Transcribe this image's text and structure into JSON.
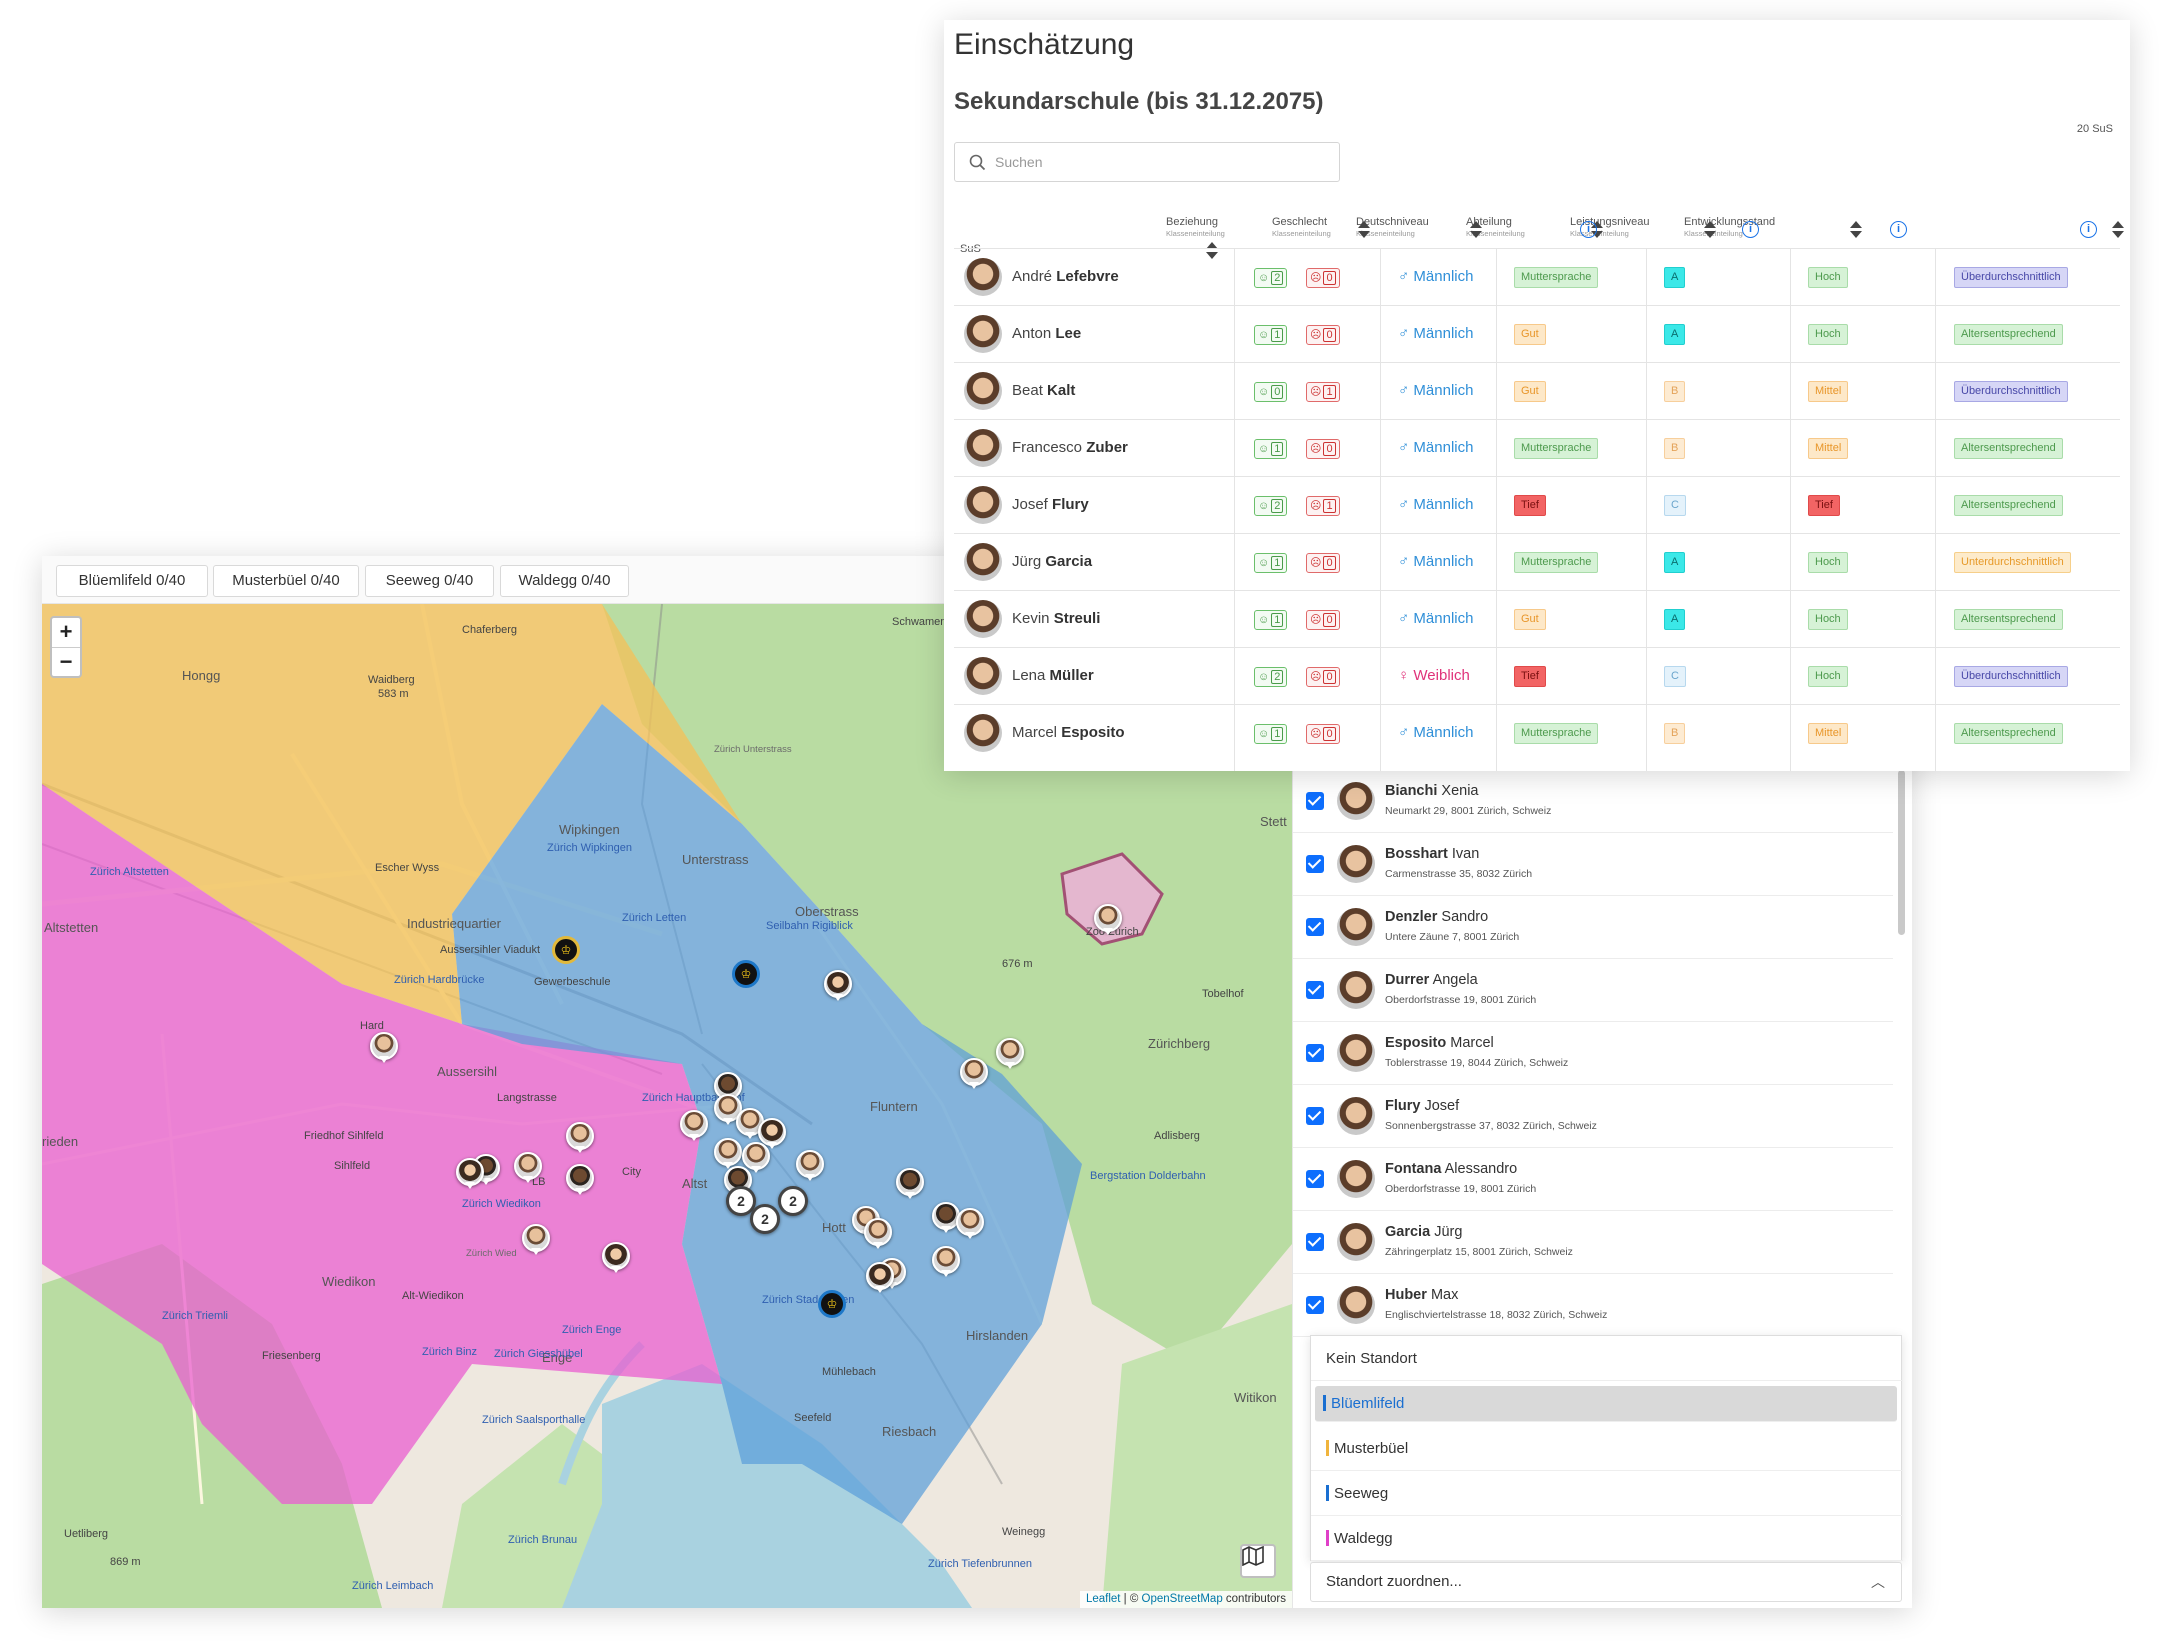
{
  "map_panel": {
    "location_tabs": [
      "Blüemlifeld 0/40",
      "Musterbüel 0/40",
      "Seeweg 0/40",
      "Waldegg 0/40"
    ],
    "zoom_in": "+",
    "zoom_out": "−",
    "attribution": {
      "leaflet": "Leaflet",
      "separator": " | © ",
      "osm": "OpenStreetMap",
      "suffix": " contributors"
    },
    "labels": {
      "hoengg": "Hongg",
      "chaeferberg": "Chaferberg",
      "waidberg": "Waidberg",
      "waidberg_h": "583 m",
      "schwamen": "Schwamen",
      "unterstrass": "Unterstrass",
      "zuerich_unterstrass": "Zürich Unterstrass",
      "wipkingen": "Wipkingen",
      "zuerich_wipkingen": "Zürich Wipkingen",
      "escher_wyss": "Escher Wyss",
      "industriequartier": "Industriequartier",
      "ausserihler_viadukt": "Aussersihler Viadukt",
      "gewerbeschule": "Gewerbeschule",
      "zuerich_altstetten": "Zürich Altstetten",
      "altstetten": "Altstetten",
      "zuerich_hardbruecke": "Zürich Hardbrücke",
      "hard": "Hard",
      "aussersihl": "Aussersihl",
      "langstrasse": "Langstrasse",
      "friedhof_sihlfeld": "Friedhof Sihlfeld",
      "sihlfeld": "Sihlfeld",
      "zuerich_hauptbahnhof": "Zürich Hauptbahnhof",
      "city": "City",
      "altstadt": "Altst",
      "lb": "LB",
      "zuerich_wiedikon": "Zürich Wiedikon",
      "wiedikon": "Wiedikon",
      "alt_wiedikon": "Alt-Wiedikon",
      "zuerich_triemli": "Zürich Triemli",
      "friesenberg": "Friesenberg",
      "zuerich_binz": "Zürich Binz",
      "zuerich_enge": "Zürich Enge",
      "enge": "Enge",
      "zuerich_giesshuebel": "Zürich Giesshübel",
      "zuerich_saalsporthalle": "Zürich Saalsporthalle",
      "hoenggerberg": "Höngg",
      "oberstrass": "Oberstrass",
      "seilbahn_rigiblick": "Seilbahn Rigiblick",
      "fluntern": "Fluntern",
      "zuerichberg": "Zürichberg",
      "zoo_zuerich": "Zoo Zürich",
      "zuerichberg_h": "676 m",
      "tobelhof": "Tobelhof",
      "adlisberg": "Adlisberg",
      "bergstation_dolderbahn": "Bergstation Dolderbahn",
      "hottingen": "Hott",
      "hirslanden": "Hirslanden",
      "zuerich_stadelhofen": "Zürich Stadelhofen",
      "muehlebach": "Mühlebach",
      "seefeld": "Seefeld",
      "riesbach": "Riesbach",
      "witikon": "Witikon",
      "weinegg": "Weinegg",
      "zuerich_tiefenbrunnen": "Zürich Tiefenbrunnen",
      "uetliberg": "Uetliberg",
      "uetliberg_h": "869 m",
      "zuerich_brunau": "Zürich Brunau",
      "zuerich_leimbach": "Zürich Leimbach",
      "zuerich_letten": "Zürich Letten",
      "stettbach": "Stett",
      "rieden": "rieden",
      "adlisberg2": "Adlisb",
      "zuerich_wiedikon2": "Zürich Wied"
    },
    "clusters": [
      "2",
      "2",
      "2"
    ]
  },
  "student_list": [
    {
      "last": "Bianchi",
      "first": "Xenia",
      "address": "Neumarkt 29, 8001 Zürich, Schweiz"
    },
    {
      "last": "Bosshart",
      "first": "Ivan",
      "address": "Carmenstrasse 35, 8032 Zürich"
    },
    {
      "last": "Denzler",
      "first": "Sandro",
      "address": "Untere Zäune 7, 8001 Zürich"
    },
    {
      "last": "Durrer",
      "first": "Angela",
      "address": "Oberdorfstrasse 19, 8001 Zürich"
    },
    {
      "last": "Esposito",
      "first": "Marcel",
      "address": "Toblerstrasse 19, 8044 Zürich, Schweiz"
    },
    {
      "last": "Flury",
      "first": "Josef",
      "address": "Sonnenbergstrasse 37, 8032 Zürich, Schweiz"
    },
    {
      "last": "Fontana",
      "first": "Alessandro",
      "address": "Oberdorfstrasse 19, 8001 Zürich"
    },
    {
      "last": "Garcia",
      "first": "Jürg",
      "address": "Zähringerplatz 15, 8001 Zürich, Schweiz"
    },
    {
      "last": "Huber",
      "first": "Max",
      "address": "Englischviertelstrasse 18, 8032 Zürich, Schweiz"
    }
  ],
  "location_dropdown": {
    "options": [
      {
        "label": "Kein Standort",
        "color": ""
      },
      {
        "label": "Blüemlifeld",
        "color": "#1a6fd1"
      },
      {
        "label": "Musterbüel",
        "color": "#f0b43c"
      },
      {
        "label": "Seeweg",
        "color": "#1a6fd1"
      },
      {
        "label": "Waldegg",
        "color": "#e040c8"
      }
    ],
    "selected": "Blüemlifeld",
    "assign_label": "Standort zuordnen..."
  },
  "assessment": {
    "title": "Einschätzung",
    "section": "Sekundarschule (bis 31.12.2075)",
    "count": "20 SuS",
    "search_placeholder": "Suchen",
    "columns": [
      {
        "label": "SuS",
        "sub": ""
      },
      {
        "label": "Beziehung",
        "sub": "Klasseneinteilung"
      },
      {
        "label": "Geschlecht",
        "sub": "Klasseneinteilung"
      },
      {
        "label": "Deutschniveau",
        "sub": "Klasseneinteilung"
      },
      {
        "label": "Abteilung",
        "sub": "Klasseneinteilung"
      },
      {
        "label": "Leistungsniveau",
        "sub": "Klasseneinteilung"
      },
      {
        "label": "Entwicklungsstand",
        "sub": "Klasseneinteilung"
      }
    ],
    "rows": [
      {
        "first": "André",
        "last": "Lefebvre",
        "pos": "2",
        "neg": "0",
        "gender": "Männlich",
        "deutsch": "Muttersprache",
        "abteilung": "A",
        "leistung": "Hoch",
        "entwicklung": "Überdurchschnittlich"
      },
      {
        "first": "Anton",
        "last": "Lee",
        "pos": "1",
        "neg": "0",
        "gender": "Männlich",
        "deutsch": "Gut",
        "abteilung": "A",
        "leistung": "Hoch",
        "entwicklung": "Altersentsprechend"
      },
      {
        "first": "Beat",
        "last": "Kalt",
        "pos": "0",
        "neg": "1",
        "gender": "Männlich",
        "deutsch": "Gut",
        "abteilung": "B",
        "leistung": "Mittel",
        "entwicklung": "Überdurchschnittlich"
      },
      {
        "first": "Francesco",
        "last": "Zuber",
        "pos": "1",
        "neg": "0",
        "gender": "Männlich",
        "deutsch": "Muttersprache",
        "abteilung": "B",
        "leistung": "Mittel",
        "entwicklung": "Altersentsprechend"
      },
      {
        "first": "Josef",
        "last": "Flury",
        "pos": "2",
        "neg": "1",
        "gender": "Männlich",
        "deutsch": "Tief",
        "abteilung": "C",
        "leistung": "Tief",
        "entwicklung": "Altersentsprechend"
      },
      {
        "first": "Jürg",
        "last": "Garcia",
        "pos": "1",
        "neg": "0",
        "gender": "Männlich",
        "deutsch": "Muttersprache",
        "abteilung": "A",
        "leistung": "Hoch",
        "entwicklung": "Unterdurchschnittlich"
      },
      {
        "first": "Kevin",
        "last": "Streuli",
        "pos": "1",
        "neg": "0",
        "gender": "Männlich",
        "deutsch": "Gut",
        "abteilung": "A",
        "leistung": "Hoch",
        "entwicklung": "Altersentsprechend"
      },
      {
        "first": "Lena",
        "last": "Müller",
        "pos": "2",
        "neg": "0",
        "gender": "Weiblich",
        "deutsch": "Tief",
        "abteilung": "C",
        "leistung": "Hoch",
        "entwicklung": "Überdurchschnittlich"
      },
      {
        "first": "Marcel",
        "last": "Esposito",
        "pos": "1",
        "neg": "0",
        "gender": "Männlich",
        "deutsch": "Muttersprache",
        "abteilung": "B",
        "leistung": "Mittel",
        "entwicklung": "Altersentsprechend"
      }
    ]
  },
  "colors": {
    "zone_blue": "#5b9ed9",
    "zone_pink": "#ea5fd0",
    "zone_yellow": "#f2c15a",
    "forest": "#b8dba0",
    "lake": "#aad3df",
    "accent": "#0d6efd",
    "male": "#2f8fd8",
    "female": "#e0337a"
  },
  "icons": {
    "search": "search-icon",
    "layers": "map-layers-icon",
    "smile": "smile-icon",
    "frown": "frown-icon",
    "male": "male-symbol-icon",
    "female": "female-symbol-icon",
    "info": "info-icon",
    "sort": "sort-icon",
    "chevron": "chevron-up-icon",
    "school": "school-icon"
  }
}
